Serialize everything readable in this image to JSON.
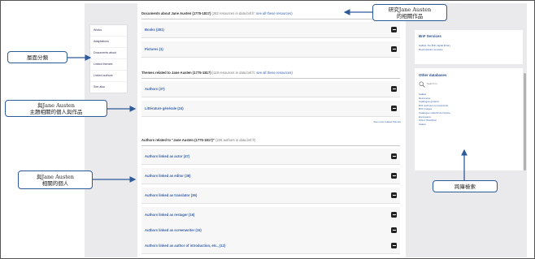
{
  "left_nav": {
    "items": [
      "Works",
      "Adaptations",
      "Documents about",
      "Linked themes",
      "Linked authors",
      "See also"
    ]
  },
  "sections": {
    "documents": {
      "title": "Documents about Jane Austen (1775-1817)",
      "count": "(282 resources in data.bnf.fr:",
      "link": "see all these resources)",
      "rows": [
        "Books (281)",
        "Pictures (1)"
      ]
    },
    "themes": {
      "title": "Themes related to Jane Austen (1775-1817)",
      "count": "(119 resources in data.bnf.fr:",
      "link": "see all these resources)",
      "rows": [
        "Authors (37)",
        "Littérature générale (24)"
      ],
      "see_more": "See more related themes"
    },
    "authors": {
      "title": "Authors related to \"Jane Austen (1775-1817)\"",
      "count": "(226 authors in data.bnf.fr)",
      "rows": [
        "Authors linked as actor (47)",
        "Authors linked as editor (38)",
        "Authors linked as translator (36)",
        "Authors linked as restager (16)",
        "Authors linked as screenwriter (15)",
        "Authors linked as author of introduction, etc., (12)"
      ]
    }
  },
  "sidebar": {
    "bnf": {
      "title": "BnF Services",
      "links": [
        "Gallica: the BnF digital library",
        "Reproduction services"
      ]
    },
    "other": {
      "title": "Other databases",
      "search_placeholder": "Search in",
      "links": [
        "Gallica",
        "Retronews",
        "Catalogue général",
        "BnF archives et manuscrits",
        "BnF Images",
        "Catalogue collectif de France",
        "Europeana",
        "OCLC WorldCat",
        "Isidore"
      ]
    }
  },
  "annotations": {
    "top": "研究Jane Austen\n的相關作品",
    "left1": "層面分類",
    "left2": "與Jane Austen\n主題相關的個人與作品",
    "left3": "與Jane Austen\n相關的個人",
    "right": "跨庫檢索"
  },
  "colors": {
    "link": "#3a62a8",
    "arrow": "#2d5b9a",
    "panel_bg": "#eaeaec"
  },
  "icons": {
    "toggle": "collapse-toggle-icon",
    "search": "search-icon"
  }
}
